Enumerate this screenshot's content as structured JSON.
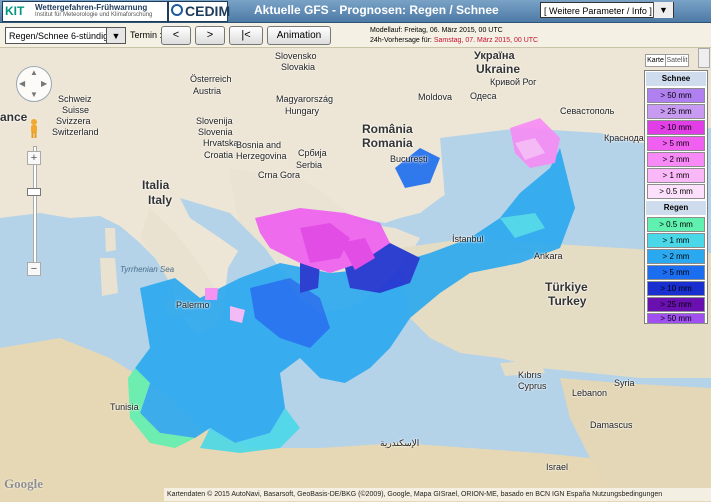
{
  "header": {
    "kit_logo_mark": "KIT",
    "kit_logo_text": "Wettergefahren-Frühwarnung",
    "kit_logo_subtext": "Institut für Meteorologie und Klimaforschung",
    "cedim_logo_text": "CEDIM",
    "title": "Aktuelle GFS - Prognosen: Regen / Schnee",
    "param_select_value": "[ Weitere Parameter / Info ]"
  },
  "toolbar": {
    "mode_select_value": "Regen/Schnee 6-stündig",
    "termin_label": "Termin :",
    "prev_label": "<",
    "next_label": ">",
    "first_label": "|<",
    "animation_label": "Animation",
    "model_run_label": "Modellauf: Freitag, 06. März 2015, 00 UTC",
    "forecast_label": "24h-Vorhersage für:",
    "forecast_date": "Samstag, 07. März 2015, 00 UTC"
  },
  "map": {
    "maptype_map": "Karte",
    "maptype_sat": "Satellit",
    "zoom_in": "+",
    "zoom_out": "−",
    "attribution": "Kartendaten © 2015 AutoNavi, Basarsoft, GeoBasis-DE/BKG (©2009), Google, Mapa GISrael, ORION-ME, basado en BCN IGN España   Nutzungsbedingungen",
    "google_logo": "Google",
    "labels": {
      "ukraine": "Ukraine",
      "ukraina": "Україна",
      "romania": "România",
      "romania_en": "Romania",
      "bucuresti": "București",
      "italia": "Italia",
      "italy": "Italy",
      "turkiye": "Türkiye",
      "turkey": "Turkey",
      "schweiz": "Schweiz",
      "suisse": "Suisse",
      "svizzera": "Svizzera",
      "switzerland": "Switzerland",
      "osterreich": "Österreich",
      "austria": "Austria",
      "slovensko": "Slovensko",
      "slovakia": "Slovakia",
      "magyarorszag": "Magyarország",
      "hungary": "Hungary",
      "slovenija": "Slovenija",
      "slovenia": "Slovenia",
      "hrvatska": "Hrvatska",
      "croatia": "Croatia",
      "bosnia": "Bosnia and",
      "herzegovina": "Herzegovina",
      "srbija": "Србија",
      "serbia": "Serbia",
      "crna_gora": "Crna Gora",
      "istanbul": "İstanbul",
      "kibris": "Kıbrıs",
      "cyprus": "Cyprus",
      "lebanon": "Lebanon",
      "syria": "Syria",
      "israel": "Israel",
      "tunisia": "Tunisia",
      "palermo": "Palermo",
      "tyrrhenian": "Tyrrhenian Sea",
      "moldova": "Moldova",
      "krasnodar": "Краснодар",
      "damascus": "Damascus",
      "france_edge": "ance",
      "krivoy_rog": "Кривой Рог",
      "odessa": "Одеса",
      "sevastopol": "Севастополь",
      "ankara": "Ankara",
      "alexandria": "الإسكندرية"
    }
  },
  "legend": {
    "schnee_title": "Schnee",
    "schnee": [
      {
        "label": "> 50 mm",
        "color": "#b080f0"
      },
      {
        "label": "> 25 mm",
        "color": "#c89af2"
      },
      {
        "label": "> 10 mm",
        "color": "#e23ee8"
      },
      {
        "label": "> 5 mm",
        "color": "#f05ff0"
      },
      {
        "label": "> 2 mm",
        "color": "#f78af6"
      },
      {
        "label": "> 1 mm",
        "color": "#fbb8f8"
      },
      {
        "label": "> 0.5 mm",
        "color": "#fde0fb"
      }
    ],
    "regen_title": "Regen",
    "regen": [
      {
        "label": "> 0.5 mm",
        "color": "#60f0b0"
      },
      {
        "label": "> 1 mm",
        "color": "#4ad8e8"
      },
      {
        "label": "> 2 mm",
        "color": "#2aa8f0"
      },
      {
        "label": "> 5 mm",
        "color": "#1c6ef0"
      },
      {
        "label": "> 10 mm",
        "color": "#1a2fd0"
      },
      {
        "label": "> 25 mm",
        "color": "#6a10b0"
      },
      {
        "label": "> 50 mm",
        "color": "#a050f0"
      }
    ]
  }
}
